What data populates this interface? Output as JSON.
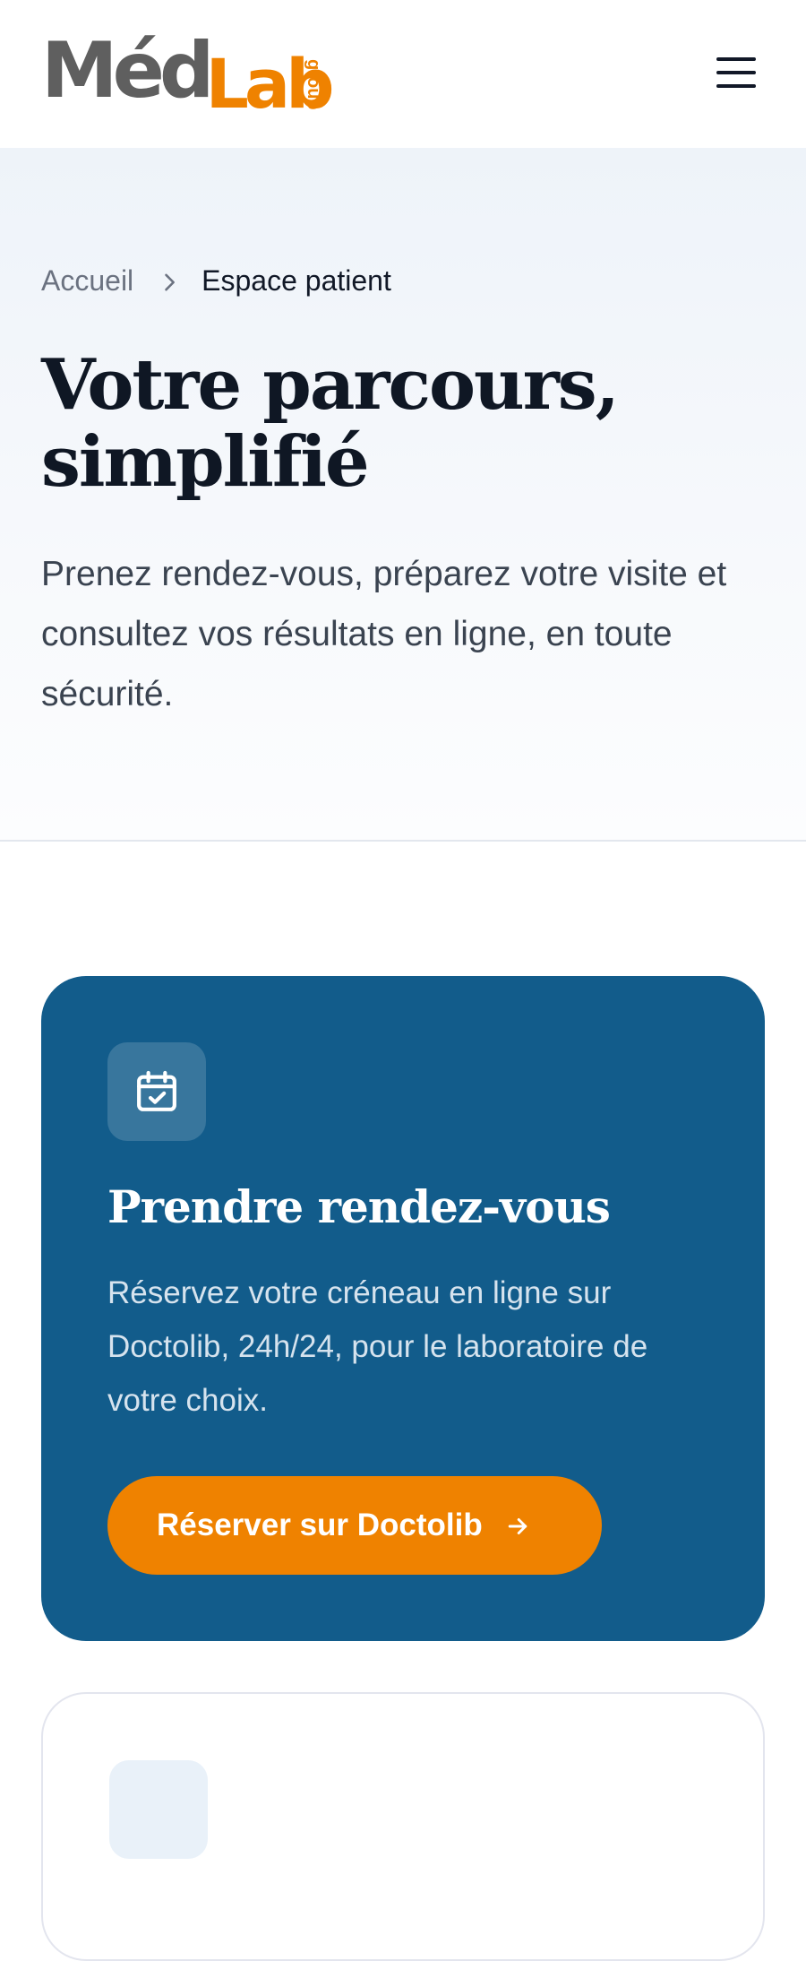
{
  "header": {
    "logo": {
      "main": "Méd",
      "accent": "Lab",
      "suffix": "group"
    },
    "menu_icon": "hamburger-menu-icon"
  },
  "hero": {
    "breadcrumb": {
      "home": "Accueil",
      "current": "Espace patient",
      "separator_icon": "chevron-right-icon"
    },
    "title_line1": "Votre parcours,",
    "title_line2": "simplifié",
    "subtitle": "Prenez rendez-vous, préparez votre visite et consultez vos résultats en ligne, en toute sécurité."
  },
  "cards": [
    {
      "icon": "calendar-check-icon",
      "title": "Prendre rendez-vous",
      "text": "Réservez votre créneau en ligne sur Doctolib, 24h/24, pour le laboratoire de votre choix.",
      "button_label": "Réserver sur Doctolib",
      "button_icon": "arrow-right-icon"
    }
  ],
  "colors": {
    "brand_orange": "#ef8200",
    "brand_gray": "#5f5f5f",
    "card_blue": "#125c8b",
    "text_dark": "#0f1724"
  }
}
